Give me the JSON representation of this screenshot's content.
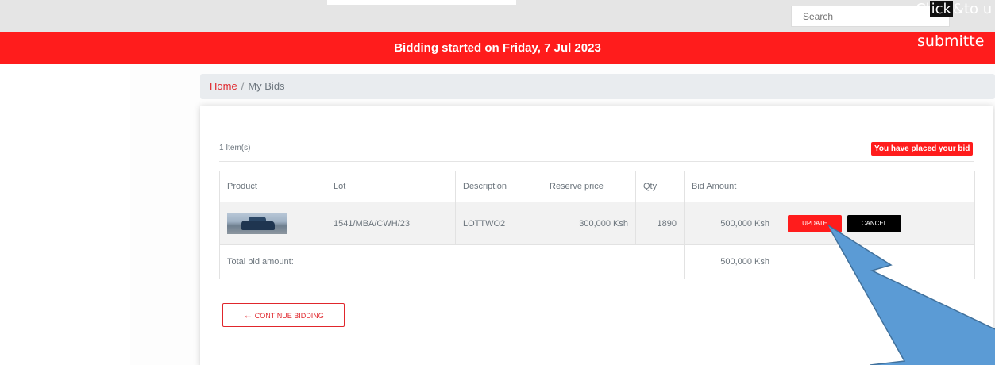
{
  "search": {
    "placeholder": "Search"
  },
  "overlay": {
    "line1_prefix": "Cl",
    "line1_mid": "ick",
    "line1_box": "&",
    "line1_suffix": "to u",
    "line2": "submitte"
  },
  "banner": {
    "text": "Bidding started on Friday, 7 Jul 2023"
  },
  "breadcrumb": {
    "home": "Home",
    "separator": "/",
    "current": "My Bids"
  },
  "summary": {
    "items_count": "1 Item(s)",
    "status_badge": "You have placed your bid"
  },
  "table": {
    "headers": [
      "Product",
      "Lot",
      "Description",
      "Reserve price",
      "Qty",
      "Bid Amount",
      ""
    ],
    "rows": [
      {
        "lot": "1541/MBA/CWH/23",
        "description": "LOTTWO2",
        "reserve_price": "300,000 Ksh",
        "qty": "1890",
        "bid_amount": "500,000 Ksh",
        "update_label": "UPDATE",
        "cancel_label": "CANCEL"
      }
    ],
    "total_label": "Total bid amount:",
    "total_value": "500,000 Ksh"
  },
  "continue_button": {
    "arrow": "←",
    "label": "CONTINUE BIDDING"
  },
  "colors": {
    "brand_red": "#ff1c1c",
    "link_red": "#e0262c",
    "arrow_blue": "#5b9bd5"
  },
  "icons": {
    "continue": "arrow-left-icon",
    "product": "car-thumbnail-image"
  }
}
